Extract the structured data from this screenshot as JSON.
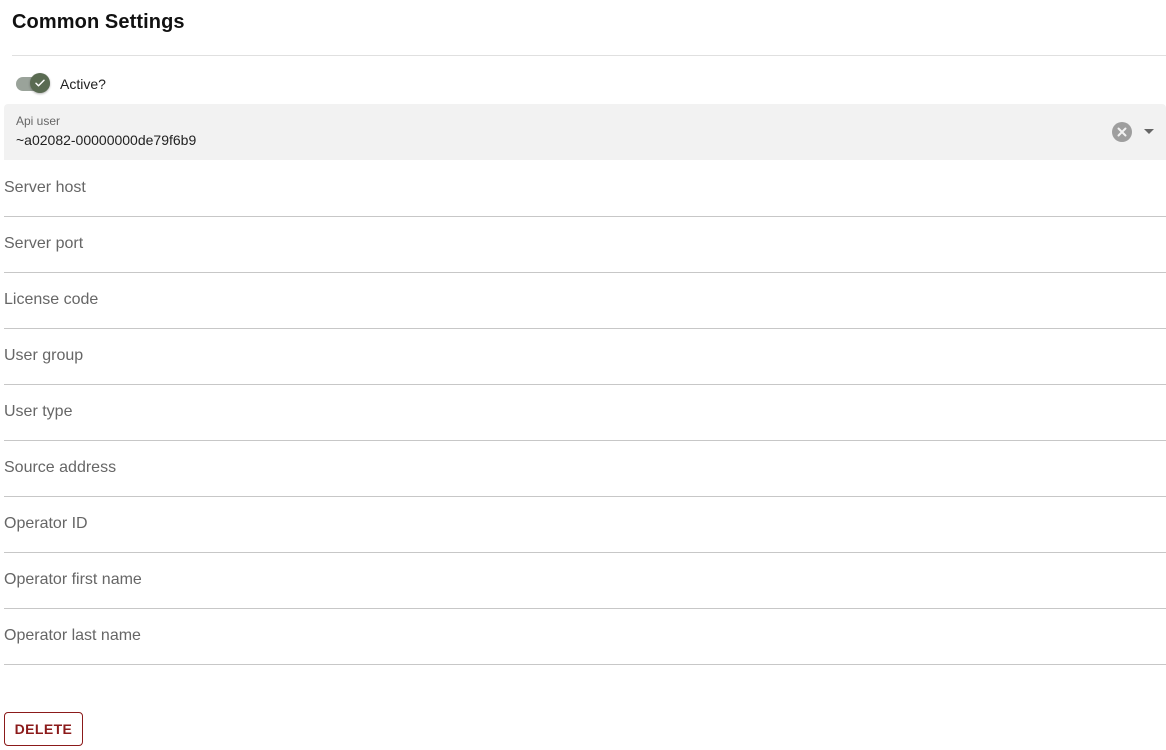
{
  "section": {
    "title": "Common Settings"
  },
  "active_toggle": {
    "label": "Active?",
    "checked": true,
    "icon": "check-icon"
  },
  "api_user": {
    "label": "Api user",
    "value": "~a02082-00000000de79f6b9",
    "clear_icon": "close-circle-icon",
    "dropdown_icon": "caret-down-icon"
  },
  "fields": {
    "server_host": "Server host",
    "server_port": "Server port",
    "license_code": "License code",
    "user_group": "User group",
    "user_type": "User type",
    "source_address": "Source address",
    "operator_id": "Operator ID",
    "operator_first_name": "Operator first name",
    "operator_last_name": "Operator last name"
  },
  "actions": {
    "delete_label": "DELETE"
  },
  "colors": {
    "toggle_thumb": "#5a6b52",
    "toggle_track": "#9aa39a",
    "delete_accent": "#8b1a1a",
    "select_background": "#f2f2f2"
  }
}
